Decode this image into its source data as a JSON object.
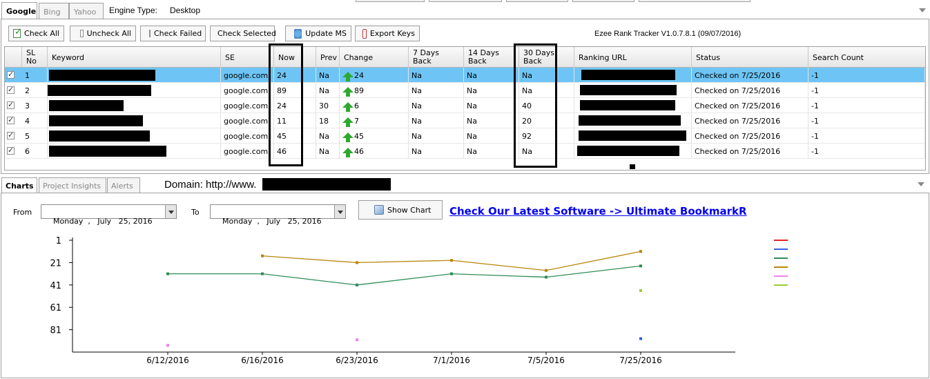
{
  "engine_tabs": [
    {
      "label": "Google",
      "active": true
    },
    {
      "label": "Bing",
      "active": false
    },
    {
      "label": "Yahoo",
      "active": false
    }
  ],
  "engine_type": {
    "label": "Engine Type:",
    "value": "Desktop"
  },
  "toolbar": {
    "check_all": "Check All",
    "uncheck_all": "Uncheck All",
    "check_failed": "Check Failed",
    "check_selected": "Check Selected",
    "update_ms": "Update MS",
    "export_keys": "Export Keys"
  },
  "version": "Ezee Rank Tracker V1.0.7.8.1 (09/07/2016)",
  "grid": {
    "headers": {
      "sl_no": [
        "SL",
        "No"
      ],
      "keyword": "Keyword",
      "se": "SE",
      "now": "Now",
      "prev": "Prev",
      "change": "Change",
      "d7": [
        "7 Days",
        "Back"
      ],
      "d14": [
        "14 Days",
        "Back"
      ],
      "d30": [
        "30 Days",
        "Back"
      ],
      "ranking_url": "Ranking URL",
      "status": "Status",
      "search_count": "Search Count"
    },
    "rows": [
      {
        "sl": "1",
        "se": "google.com",
        "now": "24",
        "prev": "Na",
        "change": "24",
        "d7": "Na",
        "d14": "Na",
        "d30": "Na",
        "status": "Checked on 7/25/2016",
        "count": "-1",
        "selected": true
      },
      {
        "sl": "2",
        "se": "google.com",
        "now": "89",
        "prev": "Na",
        "change": "89",
        "d7": "Na",
        "d14": "Na",
        "d30": "Na",
        "status": "Checked on 7/25/2016",
        "count": "-1",
        "selected": false
      },
      {
        "sl": "3",
        "se": "google.com",
        "now": "24",
        "prev": "30",
        "change": "6",
        "d7": "Na",
        "d14": "Na",
        "d30": "40",
        "status": "Checked on 7/25/2016",
        "count": "-1",
        "selected": false
      },
      {
        "sl": "4",
        "se": "google.com",
        "now": "11",
        "prev": "18",
        "change": "7",
        "d7": "Na",
        "d14": "Na",
        "d30": "20",
        "status": "Checked on 7/25/2016",
        "count": "-1",
        "selected": false
      },
      {
        "sl": "5",
        "se": "google.com",
        "now": "45",
        "prev": "Na",
        "change": "45",
        "d7": "Na",
        "d14": "Na",
        "d30": "92",
        "status": "Checked on 7/25/2016",
        "count": "-1",
        "selected": false
      },
      {
        "sl": "6",
        "se": "google.com",
        "now": "46",
        "prev": "Na",
        "change": "46",
        "d7": "Na",
        "d14": "Na",
        "d30": "Na",
        "status": "Checked on 7/25/2016",
        "count": "-1",
        "selected": false
      }
    ]
  },
  "bottom_tabs": [
    {
      "label": "Charts",
      "active": true
    },
    {
      "label": "Project Insights",
      "active": false
    },
    {
      "label": "Alerts",
      "active": false
    }
  ],
  "domain_label": "Domain: http://www.",
  "date_range": {
    "from_label": "From",
    "from_value": "Monday  ,   July   25, 2016",
    "to_label": "To",
    "to_value": "Monday  ,   July   25, 2016"
  },
  "show_chart": "Show Chart",
  "promo_link": "Check Our Latest Software -> Ultimate BookmarkR",
  "colors": {
    "selected_row": "#6ec5f5",
    "up_arrow": "#2fa82f",
    "promo_link": "#0000ee",
    "legend": [
      "#e02020",
      "#3060e0",
      "#2e8b57",
      "#b8860b",
      "#ee82ee",
      "#9acd32"
    ]
  },
  "chart_data": {
    "type": "line",
    "categories": [
      "6/12/2016",
      "6/16/2016",
      "6/23/2016",
      "7/1/2016",
      "7/5/2016",
      "7/25/2016"
    ],
    "y_ticks": [
      "1",
      "21",
      "41",
      "61",
      "81"
    ],
    "ylim": [
      1,
      101
    ],
    "y_inverted": true,
    "grid": false,
    "legend_position": "right",
    "series": [
      {
        "values": [
          null,
          null,
          null,
          null,
          null,
          null
        ],
        "color": "#e02020"
      },
      {
        "values": [
          null,
          null,
          null,
          null,
          null,
          89
        ],
        "color": "#3060e0"
      },
      {
        "values": [
          31,
          31,
          41,
          31,
          34,
          24
        ],
        "color": "#2e8b57"
      },
      {
        "values": [
          null,
          15,
          21,
          19,
          28,
          11
        ],
        "color": "#b8860b"
      },
      {
        "values": [
          95,
          null,
          90,
          null,
          null,
          null
        ],
        "color": "#ee82ee"
      },
      {
        "values": [
          null,
          null,
          null,
          null,
          null,
          46
        ],
        "color": "#9acd32"
      }
    ]
  }
}
